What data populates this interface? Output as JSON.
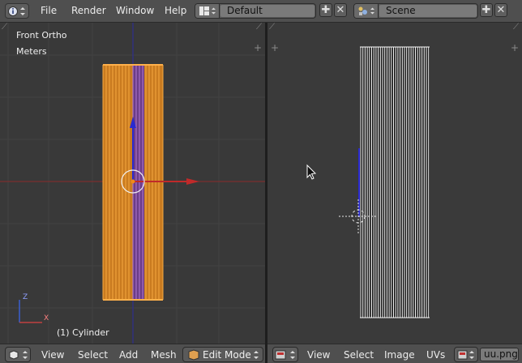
{
  "menu": {
    "file": "File",
    "render": "Render",
    "window": "Window",
    "help": "Help"
  },
  "screen_layout": {
    "value": "Default"
  },
  "scene": {
    "value": "Scene"
  },
  "viewport3d": {
    "view_name": "Front Ortho",
    "units": "Meters",
    "object_label": "(1) Cylinder",
    "axis_z": "Z",
    "axis_x": "X"
  },
  "bottom_left": {
    "view": "View",
    "select": "Select",
    "add": "Add",
    "mesh": "Mesh",
    "mode": "Edit Mode"
  },
  "bottom_right": {
    "view": "View",
    "select": "Select",
    "image": "Image",
    "uvs": "UVs",
    "image_name": "uu.png"
  },
  "colors": {
    "selected_edge": "#f58a1a",
    "face_purple": "#6e3b86",
    "grid_line": "#4a4a4a",
    "x_axis": "#b03030",
    "z_axis": "#2a2abf",
    "uv_line": "#ffffff"
  },
  "icons": {
    "info": "info-icon",
    "layout": "screen-layout-icon",
    "scene": "scene-icon",
    "add": "plus-icon",
    "close": "close-icon",
    "cursor": "mouse-cursor-icon",
    "editor_3d": "3d-view-editor-icon",
    "editor_uv": "uv-editor-icon",
    "mode": "edit-mode-icon",
    "image": "image-icon"
  }
}
